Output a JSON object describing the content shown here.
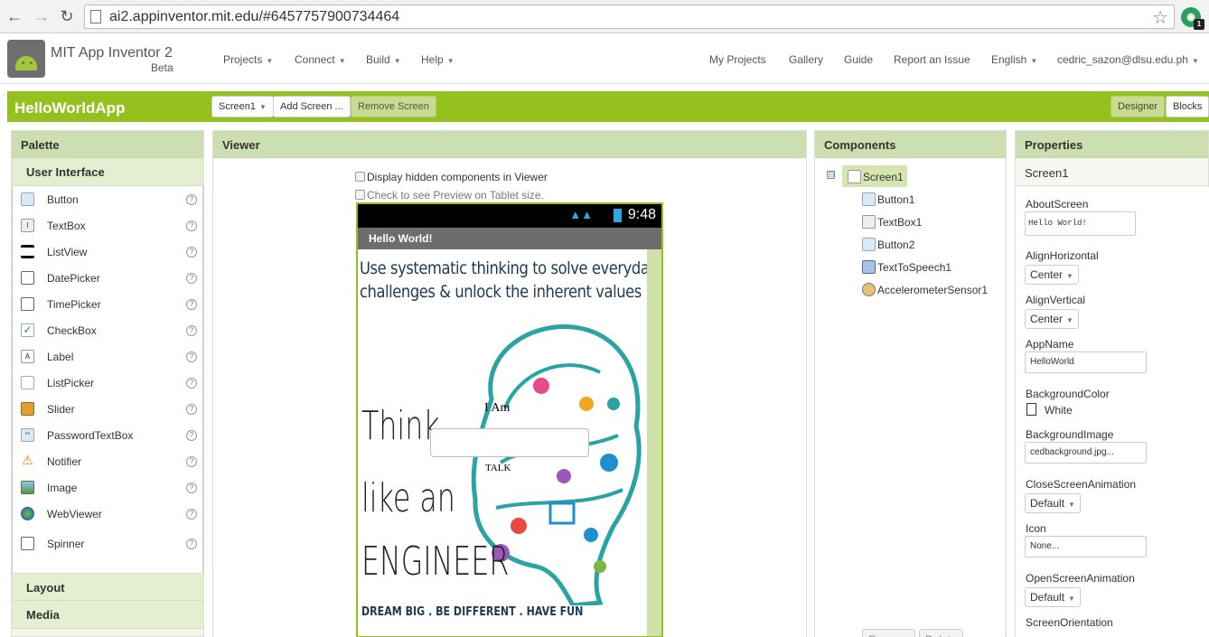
{
  "browser": {
    "url": "ai2.appinventor.mit.edu/#6457757900734464"
  },
  "header": {
    "title": "MIT App Inventor 2",
    "subtitle": "Beta",
    "menus": [
      "Projects",
      "Connect",
      "Build",
      "Help"
    ],
    "links": [
      "My Projects",
      "Gallery",
      "Guide",
      "Report an Issue",
      "English",
      "cedric_sazon@dlsu.edu.ph"
    ]
  },
  "toolbar": {
    "project_name": "HelloWorldApp",
    "screen_select": "Screen1",
    "add_screen": "Add Screen ...",
    "remove_screen": "Remove Screen",
    "designer": "Designer",
    "blocks": "Blocks"
  },
  "palette": {
    "title": "Palette",
    "section": "User Interface",
    "items": [
      "Button",
      "TextBox",
      "ListView",
      "DatePicker",
      "TimePicker",
      "CheckBox",
      "Label",
      "ListPicker",
      "Slider",
      "PasswordTextBox",
      "Notifier",
      "Image",
      "WebViewer",
      "Spinner"
    ],
    "help": "?",
    "sections": [
      "Layout",
      "Media"
    ]
  },
  "viewer": {
    "title": "Viewer",
    "display_hidden": "Display hidden components in Viewer",
    "tablet_preview": "Check to see Preview on Tablet size.",
    "phone": {
      "time": "9:48",
      "app_title": "Hello World!",
      "bg_line1": "Use systematic thinking to solve everyday",
      "bg_line2": "challenges & unlock the inherent values in them",
      "bg_think": "Think",
      "bg_like": "like an",
      "bg_engineer": "ENGINEER",
      "bg_footer": "DREAM BIG . BE DIFFERENT . HAVE FUN",
      "label_text": "I Am",
      "button_text": "TALK"
    }
  },
  "components": {
    "title": "Components",
    "tree_toggle": "⊟",
    "root": "Screen1",
    "children": [
      "Button1",
      "TextBox1",
      "Button2",
      "TextToSpeech1",
      "AccelerometerSensor1"
    ],
    "rename": "Rename",
    "delete": "Delete"
  },
  "properties": {
    "title": "Properties",
    "selected": "Screen1",
    "about_label": "AboutScreen",
    "about_value": "Hello World!",
    "align_h_label": "AlignHorizontal",
    "align_h_value": "Center",
    "align_v_label": "AlignVertical",
    "align_v_value": "Center",
    "appname_label": "AppName",
    "appname_value": "HelloWorld",
    "bgcolor_label": "BackgroundColor",
    "bgcolor_value": "White",
    "bgimage_label": "BackgroundImage",
    "bgimage_value": "cedbackground.jpg...",
    "close_anim_label": "CloseScreenAnimation",
    "close_anim_value": "Default",
    "icon_label": "Icon",
    "icon_value": "None...",
    "open_anim_label": "OpenScreenAnimation",
    "open_anim_value": "Default",
    "orientation_label": "ScreenOrientation"
  },
  "colors": {
    "brand_green": "#95c11f",
    "panel_header": "#cddfb0"
  }
}
